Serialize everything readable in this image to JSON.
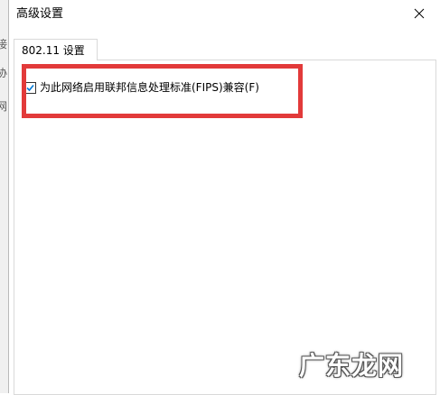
{
  "backdrop": {
    "glyphs": [
      "接",
      "协",
      "网"
    ]
  },
  "dialog": {
    "title": "高级设置",
    "close_icon": "close-icon"
  },
  "tabs": [
    {
      "label": "802.11 设置",
      "selected": true
    }
  ],
  "options": {
    "fips": {
      "label": "为此网络启用联邦信息处理标准(FIPS)兼容(F)",
      "checked": true
    }
  },
  "annotation": {
    "color": "#e23a3a"
  },
  "watermark": {
    "text": "广东龙网"
  },
  "colors": {
    "accent": "#0078d7",
    "highlight": "#e23a3a"
  }
}
